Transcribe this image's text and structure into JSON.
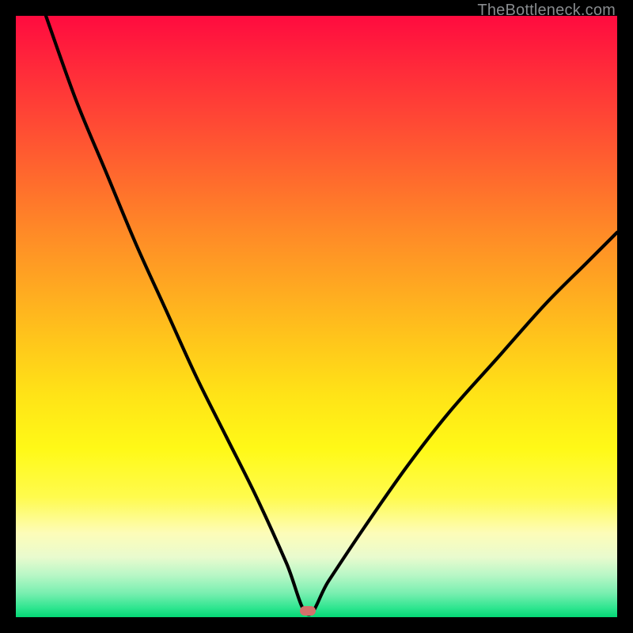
{
  "watermark": "TheBottleneck.com",
  "marker": {
    "x_pct": 48.5,
    "y_pct": 99.0,
    "color": "#d4716b"
  },
  "chart_data": {
    "type": "line",
    "title": "",
    "xlabel": "",
    "ylabel": "",
    "xlim": [
      0,
      100
    ],
    "ylim": [
      0,
      100
    ],
    "grid": false,
    "legend": false,
    "series": [
      {
        "name": "bottleneck-curve",
        "x": [
          5,
          10,
          15,
          20,
          25,
          30,
          35,
          40,
          45,
          48.5,
          52,
          58,
          65,
          72,
          80,
          88,
          95,
          100
        ],
        "y": [
          100,
          86,
          74,
          62,
          51,
          40,
          30,
          20,
          9,
          0.5,
          6,
          15,
          25,
          34,
          43,
          52,
          59,
          64
        ]
      }
    ],
    "background_gradient": {
      "top": "#ff0b3f",
      "mid": "#ffe317",
      "bottom": "#04d775"
    },
    "minimum_point": {
      "x": 48.5,
      "y": 0.5
    }
  }
}
